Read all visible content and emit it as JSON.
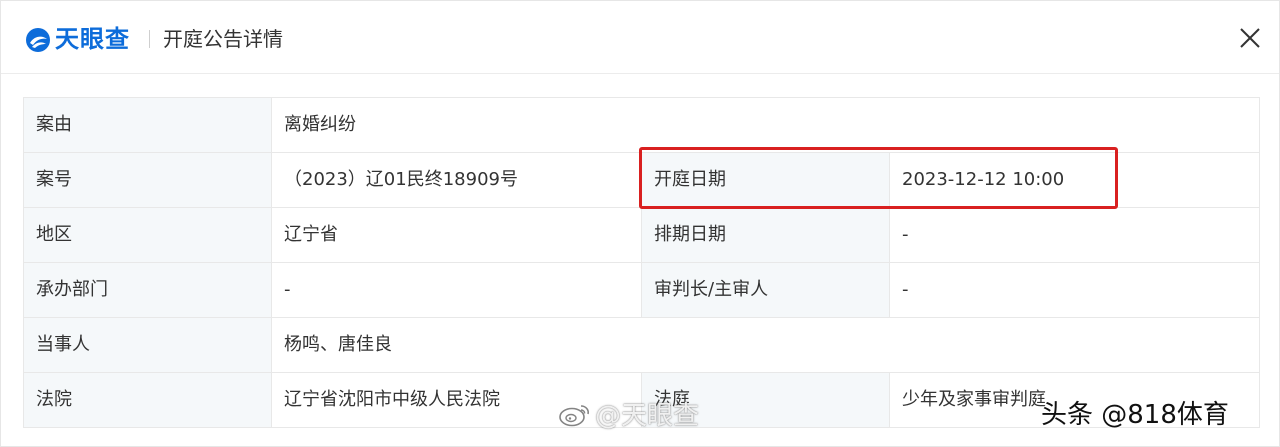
{
  "header": {
    "logo_text": "天眼查",
    "title": "开庭公告详情",
    "brand_color": "#0d6cda"
  },
  "table": {
    "rows": [
      {
        "label1": "案由",
        "value1": "离婚纠纷",
        "label2": "",
        "value2": ""
      },
      {
        "label1": "案号",
        "value1": "（2023）辽01民终18909号",
        "label2": "开庭日期",
        "value2": "2023-12-12 10:00"
      },
      {
        "label1": "地区",
        "value1": "辽宁省",
        "label2": "排期日期",
        "value2": "-"
      },
      {
        "label1": "承办部门",
        "value1": "-",
        "label2": "审判长/主审人",
        "value2": "-"
      },
      {
        "label1": "当事人",
        "value1": "杨鸣、唐佳良",
        "label2": "",
        "value2": ""
      },
      {
        "label1": "法院",
        "value1": "辽宁省沈阳市中级人民法院",
        "label2": "法庭",
        "value2": "少年及家事审判庭"
      }
    ]
  },
  "highlight_color": "#d92020",
  "watermarks": {
    "center": "@天眼查",
    "right": "头条 @818体育"
  }
}
